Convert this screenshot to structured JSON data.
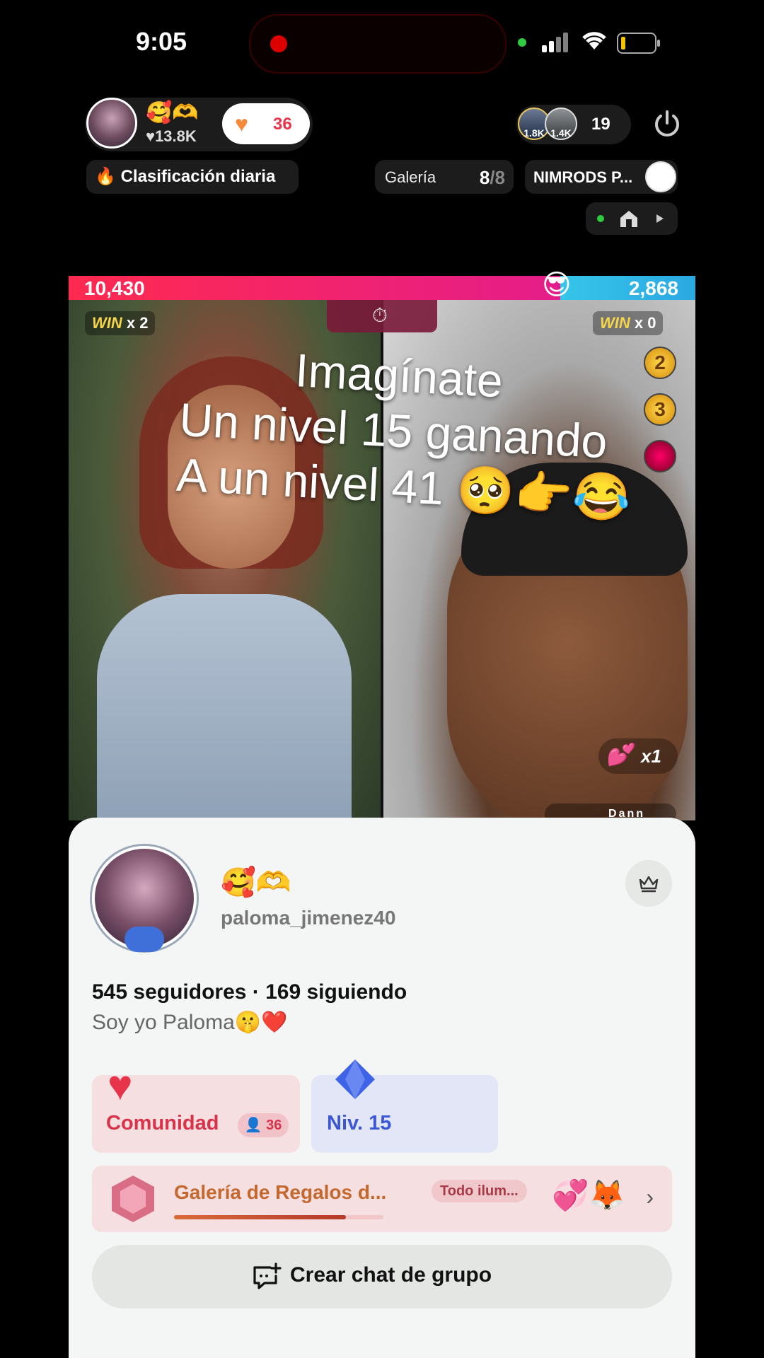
{
  "status_bar": {
    "time": "9:05"
  },
  "host": {
    "emoji": "🥰🫶",
    "likes": "♥13.8K",
    "like_count": "36"
  },
  "viewers": {
    "avatar1_label": "1.8K",
    "avatar2_label": "1.4K",
    "count": "19"
  },
  "pills": {
    "daily_rank": "Clasificación diaria",
    "gallery_label": "Galería",
    "gallery_count": "8",
    "gallery_total": "/8",
    "nimrods": "NIMRODS P..."
  },
  "battle": {
    "left_score": "10,430",
    "right_score": "2,868",
    "left_win_word": "WIN",
    "left_win_count": "x 2",
    "right_win_word": "WIN",
    "right_win_count": "x 0",
    "rank_badges": [
      "2",
      "3"
    ],
    "overlay_lines": [
      "Imagínate",
      "Un nivel 15 ganando",
      "A un nivel 41 🥺👉😂"
    ],
    "multiplier": "x1",
    "dann_label": "Dann"
  },
  "chart_data": {
    "type": "bar",
    "categories": [
      "left",
      "right"
    ],
    "values": [
      10430,
      2868
    ]
  },
  "profile": {
    "emoji": "🥰🫶",
    "username": "paloma_jimenez40",
    "stats": "545 seguidores · 169 siguiendo",
    "bio": "Soy yo Paloma🤫❤️",
    "community_label": "Comunidad",
    "community_count": "36",
    "level_label": "Niv. 15",
    "gallery_bar_label": "Galería de Regalos d...",
    "gallery_bar_tag": "Todo ilum...",
    "gallery_progress": 0.82,
    "group_chat_label": "Crear chat de grupo"
  },
  "colors": {
    "battle_left": "#ff2a4f",
    "battle_right": "#36c5e9",
    "community_red": "#d9334a",
    "level_blue": "#3b57d4"
  }
}
